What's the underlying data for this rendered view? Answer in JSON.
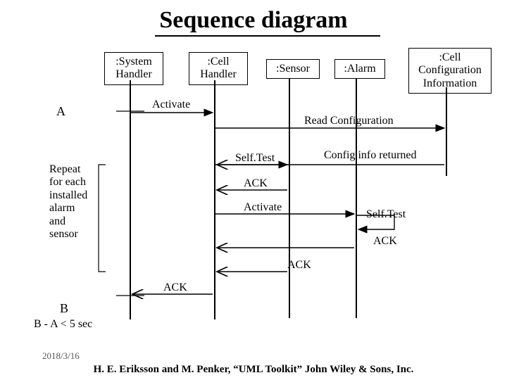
{
  "title": "Sequence diagram",
  "participants": {
    "p1": ":System\nHandler",
    "p2": ":Cell\nHandler",
    "p3": ":Sensor",
    "p4": ":Alarm",
    "p5": ":Cell\nConfiguration\nInformation"
  },
  "labels": {
    "markerA": "A",
    "markerB": "B",
    "constraint": "B - A < 5 sec",
    "loopNote": "Repeat\nfor each\ninstalled\nalarm\nand\nsensor"
  },
  "messages": {
    "activate1": "Activate",
    "readConfig": "Read Configuration",
    "configReturned": "Config info returned",
    "selfTestSensor": "Self.Test",
    "ack1": "ACK",
    "activate2": "Activate",
    "selfTestAlarm": "Self.Test",
    "ack2": "ACK",
    "ack3": "ACK",
    "ackFinal": "ACK"
  },
  "footer": {
    "date": "2018/3/16",
    "cite": "H. E. Eriksson and M. Penker, “UML Toolkit” John Wiley & Sons, Inc."
  },
  "chart_data": {
    "type": "table",
    "diagram": "UML sequence diagram",
    "participants": [
      ":System Handler",
      ":Cell Handler",
      ":Sensor",
      ":Alarm",
      ":Cell Configuration Information"
    ],
    "timeMarkers": [
      "A",
      "B"
    ],
    "constraint": "B - A < 5 sec",
    "loopFragment": {
      "over": [
        ":Sensor",
        ":Alarm"
      ],
      "condition": "Repeat for each installed alarm and sensor",
      "messages": [
        {
          "from": ":Cell Handler",
          "to": ":Sensor",
          "label": "Self.Test",
          "type": "sync"
        },
        {
          "from": ":Sensor",
          "to": ":Cell Handler",
          "label": "ACK",
          "type": "return"
        },
        {
          "from": ":Cell Handler",
          "to": ":Alarm",
          "label": "Activate",
          "type": "sync"
        },
        {
          "from": ":Alarm",
          "to": ":Alarm",
          "label": "Self.Test",
          "type": "self"
        },
        {
          "from": ":Alarm",
          "to": ":Cell Handler",
          "label": "ACK",
          "type": "return"
        },
        {
          "from": ":Sensor",
          "to": ":Cell Handler",
          "label": "ACK",
          "type": "return"
        }
      ]
    },
    "messages": [
      {
        "from": ":System Handler",
        "to": ":Cell Handler",
        "label": "Activate",
        "type": "sync",
        "at": "A"
      },
      {
        "from": ":Cell Handler",
        "to": ":Cell Configuration Information",
        "label": "Read Configuration",
        "type": "sync"
      },
      {
        "from": ":Cell Configuration Information",
        "to": ":Cell Handler",
        "label": "Config info returned",
        "type": "return"
      },
      {
        "fragment": "loop"
      },
      {
        "from": ":Cell Handler",
        "to": ":System Handler",
        "label": "ACK",
        "type": "return",
        "at": "B"
      }
    ]
  }
}
